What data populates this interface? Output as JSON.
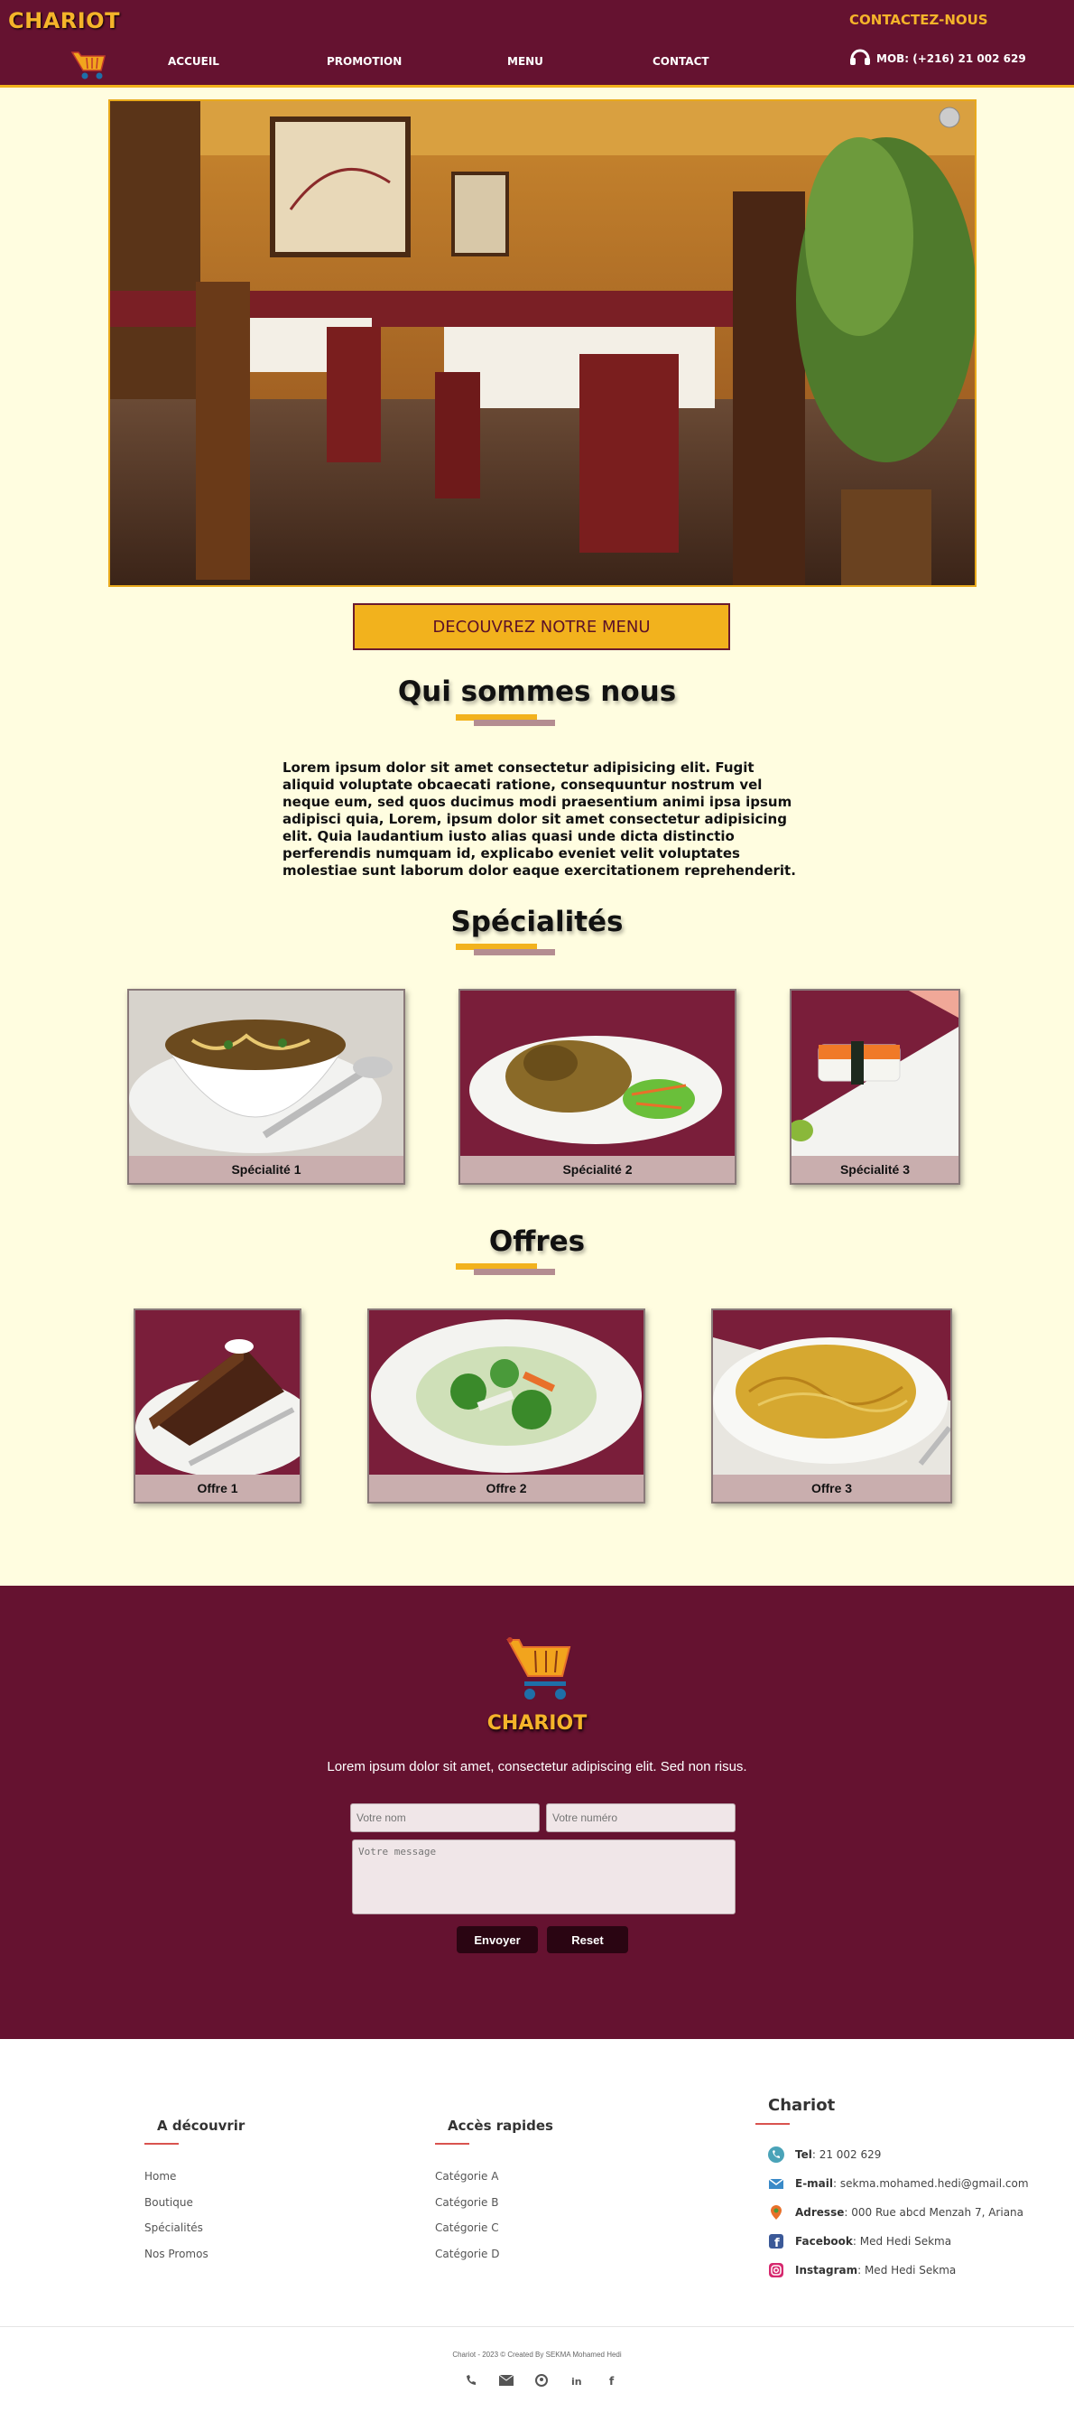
{
  "header": {
    "brand": "CHARIOT",
    "contact_label": "CONTACTEZ-NOUS",
    "phone": "MOB: (+216) 21 002 629",
    "nav": [
      "ACCUEIL",
      "PROMOTION",
      "MENU",
      "CONTACT"
    ]
  },
  "hero": {
    "cta_label": "DECOUVREZ NOTRE MENU"
  },
  "about": {
    "title": "Qui sommes nous",
    "text": "Lorem ipsum dolor sit amet consectetur adipisicing elit. Fugit aliquid voluptate obcaecati ratione, consequuntur nostrum vel neque eum, sed quos ducimus modi praesentium animi ipsa ipsum adipisci quia, Lorem, ipsum dolor sit amet consectetur adipisicing elit. Quia laudantium iusto alias quasi unde dicta distinctio perferendis numquam id, explicabo eveniet velit voluptates molestiae sunt laborum dolor eaque exercitationem reprehenderit."
  },
  "specialties": {
    "title": "Spécialités",
    "items": [
      "Spécialité 1",
      "Spécialité 2",
      "Spécialité 3"
    ]
  },
  "offers": {
    "title": "Offres",
    "items": [
      "Offre 1",
      "Offre 2",
      "Offre 3"
    ]
  },
  "contact_band": {
    "brand": "CHARIOT",
    "text": "Lorem ipsum dolor sit amet, consectetur adipiscing elit. Sed non risus.",
    "name_placeholder": "Votre nom",
    "number_placeholder": "Votre numéro",
    "message_placeholder": "Votre message",
    "send_label": "Envoyer",
    "reset_label": "Reset"
  },
  "footer": {
    "col1": {
      "title": "A découvrir",
      "links": [
        "Home",
        "Boutique",
        "Spécialités",
        "Nos Promos"
      ]
    },
    "col2": {
      "title": "Accès rapides",
      "links": [
        "Catégorie A",
        "Catégorie B",
        "Catégorie C",
        "Catégorie D"
      ]
    },
    "col3": {
      "title": "Chariot",
      "items": [
        {
          "label": "Tel",
          "value": "21 002 629"
        },
        {
          "label": "E-mail",
          "value": "sekma.mohamed.hedi@gmail.com"
        },
        {
          "label": "Adresse",
          "value": "000 Rue abcd Menzah 7, Ariana"
        },
        {
          "label": "Facebook",
          "value": "Med Hedi Sekma"
        },
        {
          "label": "Instagram",
          "value": "Med Hedi Sekma"
        }
      ]
    },
    "copyright": "Chariot - 2023 © Created By SEKMA Mohamed Hedi"
  }
}
